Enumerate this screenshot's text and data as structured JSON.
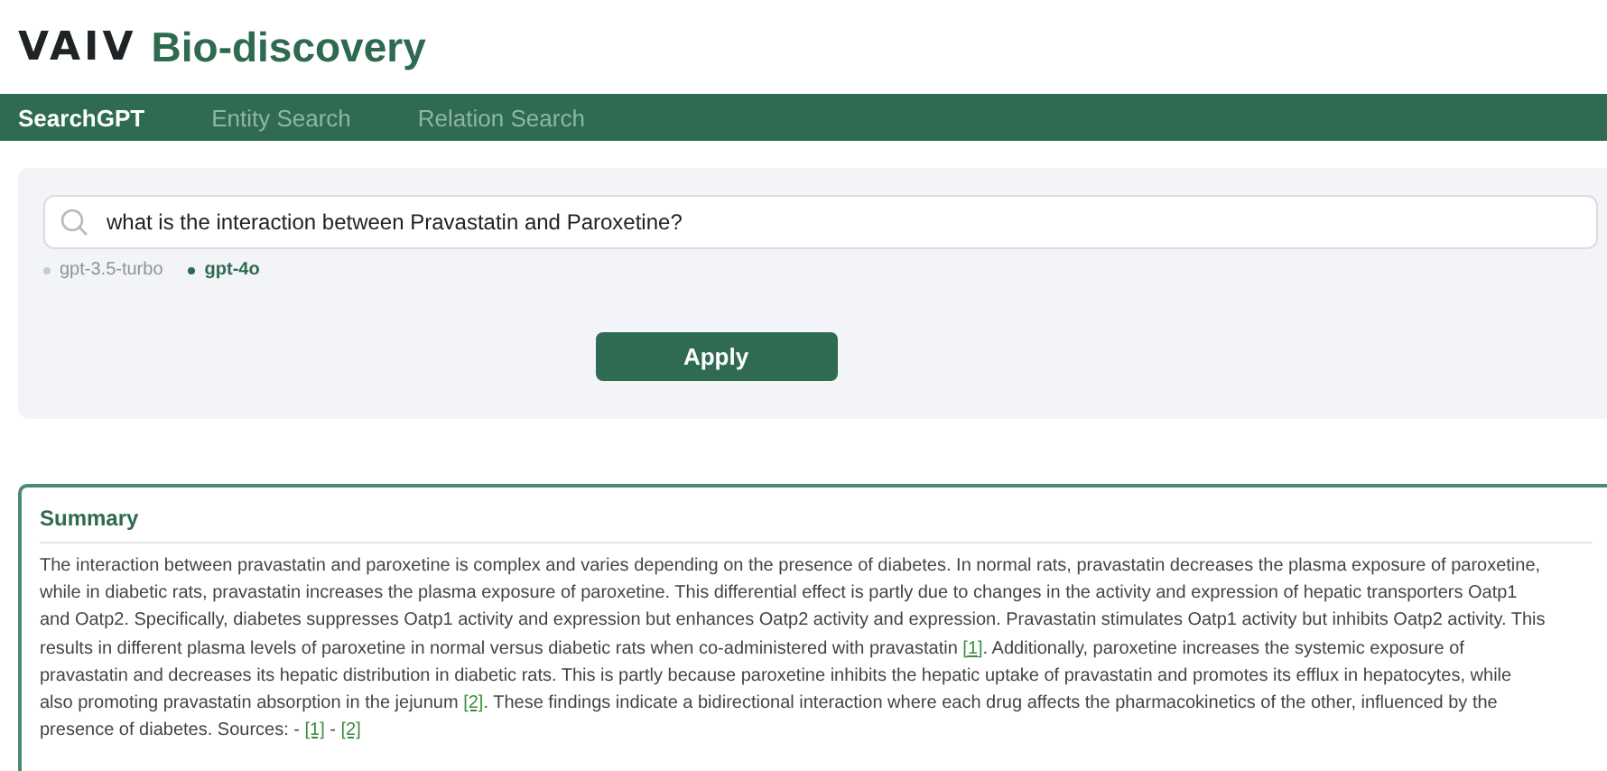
{
  "brand": {
    "logo": "VAIV",
    "title": "Bio-discovery"
  },
  "tabs": [
    {
      "label": "SearchGPT",
      "selected": true
    },
    {
      "label": "Entity Search",
      "selected": false
    },
    {
      "label": "Relation Search",
      "selected": false
    }
  ],
  "search": {
    "value": "what is the interaction between Pravastatin and Paroxetine?"
  },
  "models": [
    {
      "label": "gpt-3.5-turbo",
      "selected": false
    },
    {
      "label": "gpt-4o",
      "selected": true
    }
  ],
  "apply_button": "Apply",
  "summary": {
    "title": "Summary",
    "segments": [
      {
        "kind": "text",
        "text": "The interaction between pravastatin and paroxetine is complex and varies depending on the presence of diabetes. In normal rats, pravastatin decreases the plasma exposure of paroxetine, while in diabetic rats, pravastatin increases the plasma exposure of paroxetine. This differential effect is partly due to changes in the activity and expression of hepatic transporters Oatp1 and Oatp2. Specifically, diabetes suppresses Oatp1 activity and expression but enhances Oatp2 activity and expression. Pravastatin stimulates Oatp1 activity but inhibits Oatp2 activity. This results in different plasma levels of paroxetine in normal versus diabetic rats when co-administered with pravastatin "
      },
      {
        "kind": "link",
        "text": "[1]"
      },
      {
        "kind": "text",
        "text": ". Additionally, paroxetine increases the systemic exposure of pravastatin and decreases its hepatic distribution in diabetic rats. This is partly because paroxetine inhibits the hepatic uptake of pravastatin and promotes its efflux in hepatocytes, while also promoting pravastatin absorption in the jejunum "
      },
      {
        "kind": "link",
        "text": "[2]"
      },
      {
        "kind": "text",
        "text": ". These findings indicate a bidirectional interaction where each drug affects the pharmacokinetics of the other, influenced by the presence of diabetes. Sources: - "
      },
      {
        "kind": "link",
        "text": "[1]"
      },
      {
        "kind": "text",
        "text": " - "
      },
      {
        "kind": "link",
        "text": "[2]"
      }
    ]
  }
}
